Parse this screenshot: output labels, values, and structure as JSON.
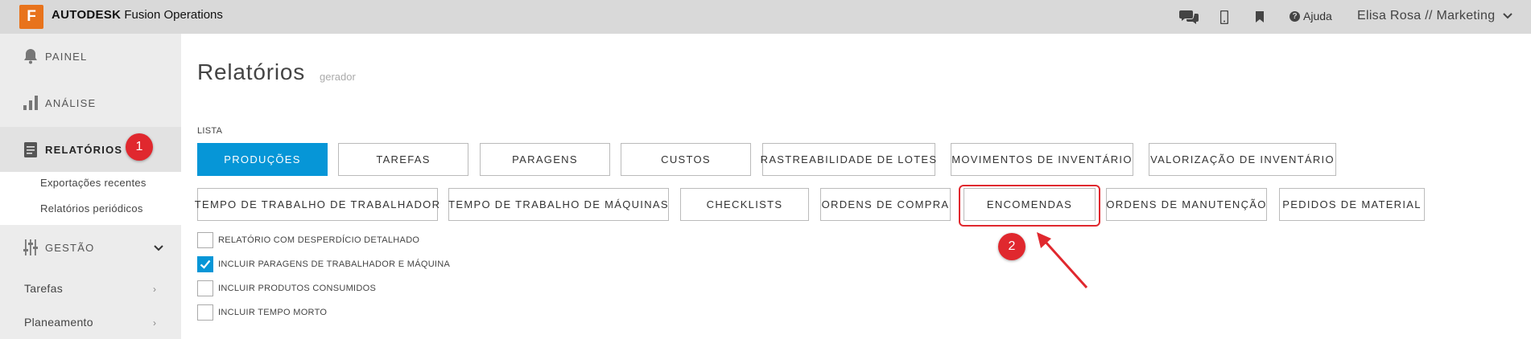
{
  "header": {
    "logo_letter": "F",
    "brand_bold": "AUTODESK",
    "brand_rest": "Fusion Operations",
    "help_label": "Ajuda",
    "user_label": "Elisa Rosa // Marketing",
    "icons": [
      "chat-icon",
      "mobile-icon",
      "bookmark-icon",
      "question-icon",
      "chevron-down-icon"
    ]
  },
  "sidebar": {
    "items": [
      {
        "label": "PAINEL",
        "icon": "bell-icon"
      },
      {
        "label": "ANÁLISE",
        "icon": "bar-chart-icon"
      },
      {
        "label": "RELATÓRIOS",
        "icon": "document-icon",
        "active": true
      },
      {
        "label": "GESTÃO",
        "icon": "sliders-icon"
      }
    ],
    "subitems": [
      "Exportações recentes",
      "Relatórios periódicos"
    ],
    "plain_items": [
      "Tarefas",
      "Planeamento"
    ]
  },
  "main": {
    "title": "Relatórios",
    "subtitle": "gerador",
    "list_label": "LISTA",
    "buttons_row1": [
      "PRODUÇÕES",
      "TAREFAS",
      "PARAGENS",
      "CUSTOS",
      "RASTREABILIDADE DE LOTES",
      "MOVIMENTOS DE INVENTÁRIO",
      "VALORIZAÇÃO DE INVENTÁRIO"
    ],
    "buttons_row2": [
      "TEMPO DE TRABALHO DE TRABALHADOR",
      "TEMPO DE TRABALHO DE MÁQUINAS",
      "CHECKLISTS",
      "ORDENS DE COMPRA",
      "ENCOMENDAS",
      "ORDENS DE MANUTENÇÃO",
      "PEDIDOS DE MATERIAL"
    ],
    "selected_button": "PRODUÇÕES",
    "checkboxes": [
      {
        "label": "RELATÓRIO COM DESPERDÍCIO DETALHADO",
        "checked": false
      },
      {
        "label": "INCLUIR PARAGENS DE TRABALHADOR E MÁQUINA",
        "checked": true
      },
      {
        "label": "INCLUIR PRODUTOS CONSUMIDOS",
        "checked": false
      },
      {
        "label": "INCLUIR TEMPO MORTO",
        "checked": false
      }
    ]
  },
  "annotations": {
    "badge1": "1",
    "badge2": "2"
  },
  "colors": {
    "accent": "#0696d7",
    "brand": "#e8731c",
    "annotation": "#e0282e"
  }
}
